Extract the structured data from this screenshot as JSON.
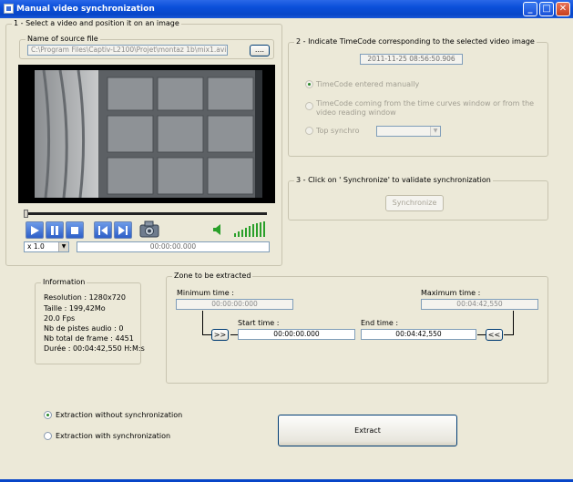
{
  "window": {
    "title": "Manual video synchronization"
  },
  "section1": {
    "legend": "1 - Select a video and position it on an image",
    "source": {
      "legend": "Name of source file",
      "path": "C:\\Program Files\\Captiv-L2100\\Projet\\montaz 1b\\mix1.avi",
      "browse_label": "...."
    },
    "speed": "x 1.0",
    "time": "00:00:00.000"
  },
  "section2": {
    "legend": "2 - Indicate TimeCode corresponding to the selected video image",
    "timecode": "2011-11-25 08:56:50.906",
    "options": [
      {
        "label": "TimeCode entered manually"
      },
      {
        "label": "TimeCode coming from the time curves window or from the video reading window"
      },
      {
        "label": "Top synchro"
      }
    ]
  },
  "section3": {
    "legend": "3 - Click on ' Synchronize' to validate synchronization",
    "synchronize_label": "Synchronize"
  },
  "information": {
    "legend": "Information",
    "lines": [
      "Resolution : 1280x720",
      "Taille : 199,42Mo",
      "20.0 Fps",
      "Nb de pistes audio :  0",
      "Nb total de frame : 4451",
      "Durée : 00:04:42,550 H:M:s"
    ]
  },
  "zone": {
    "legend": "Zone to be extracted",
    "min_label": "Minimum time :",
    "min_value": "00:00:00:000",
    "max_label": "Maximum time :",
    "max_value": "00:04:42,550",
    "start_label": "Start time :",
    "start_value": "00:00:00.000",
    "end_label": "End time :",
    "end_value": "00:04:42,550",
    "to_start_label": ">>",
    "to_end_label": "<<"
  },
  "extraction": {
    "without_label": "Extraction without synchronization",
    "with_label": "Extraction with synchronization",
    "extract_label": "Extract"
  },
  "colors": {
    "titlebar": "#0a4fd9",
    "face": "#ece9d8",
    "control_blue": "#2d5fc8",
    "volume_green": "#2aa02a"
  }
}
